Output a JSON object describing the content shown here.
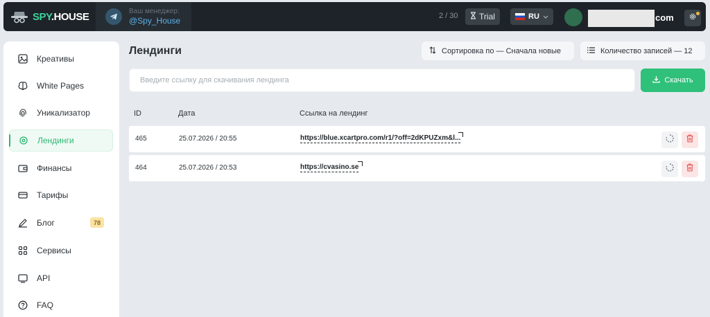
{
  "header": {
    "logo_prefix": "SPY",
    "logo_suffix": ".HOUSE",
    "manager_label": "Ваш менеджер:",
    "manager_handle": "@Spy_House",
    "counter": "2 / 30",
    "trial_label": "Trial",
    "lang_label": "RU",
    "email_tail": "com",
    "icons": [
      "spy-logo-icon",
      "telegram-icon",
      "hourglass-icon",
      "ru-flag-icon",
      "chevron-down-icon",
      "gear-icon"
    ]
  },
  "sidebar": {
    "items": [
      {
        "label": "Креативы",
        "icon": "image-icon"
      },
      {
        "label": "White Pages",
        "icon": "brain-icon"
      },
      {
        "label": "Уникализатор",
        "icon": "fingerprint-icon"
      },
      {
        "label": "Лендинги",
        "icon": "target-icon"
      },
      {
        "label": "Финансы",
        "icon": "wallet-icon"
      },
      {
        "label": "Тарифы",
        "icon": "card-icon"
      },
      {
        "label": "Блог",
        "icon": "pen-icon",
        "badge": "78"
      },
      {
        "label": "Сервисы",
        "icon": "grid-icon"
      },
      {
        "label": "API",
        "icon": "api-icon"
      },
      {
        "label": "FAQ",
        "icon": "question-icon"
      }
    ],
    "active_index": 3
  },
  "main": {
    "title": "Лендинги",
    "sort_label": "Сортировка по — Сначала новые",
    "count_label": "Количество записей — 12",
    "url_placeholder": "Введите ссылку для скачивания лендинга",
    "download_label": "Скачать",
    "columns": [
      "ID",
      "Дата",
      "Ссылка на лендинг"
    ],
    "rows": [
      {
        "id": "465",
        "date": "25.07.2026 / 20:55",
        "link": "https://blue.xcartpro.com/r1/?off=2dKPUZxm&l..."
      },
      {
        "id": "464",
        "date": "25.07.2026 / 20:53",
        "link": "https://cvasino.se"
      }
    ]
  },
  "colors": {
    "accent": "#2fc07a",
    "topbar": "#1d2328",
    "link_blue": "#5eb2e8",
    "delete_red": "#e05252",
    "badge_yellow": "#fbe3a6"
  }
}
